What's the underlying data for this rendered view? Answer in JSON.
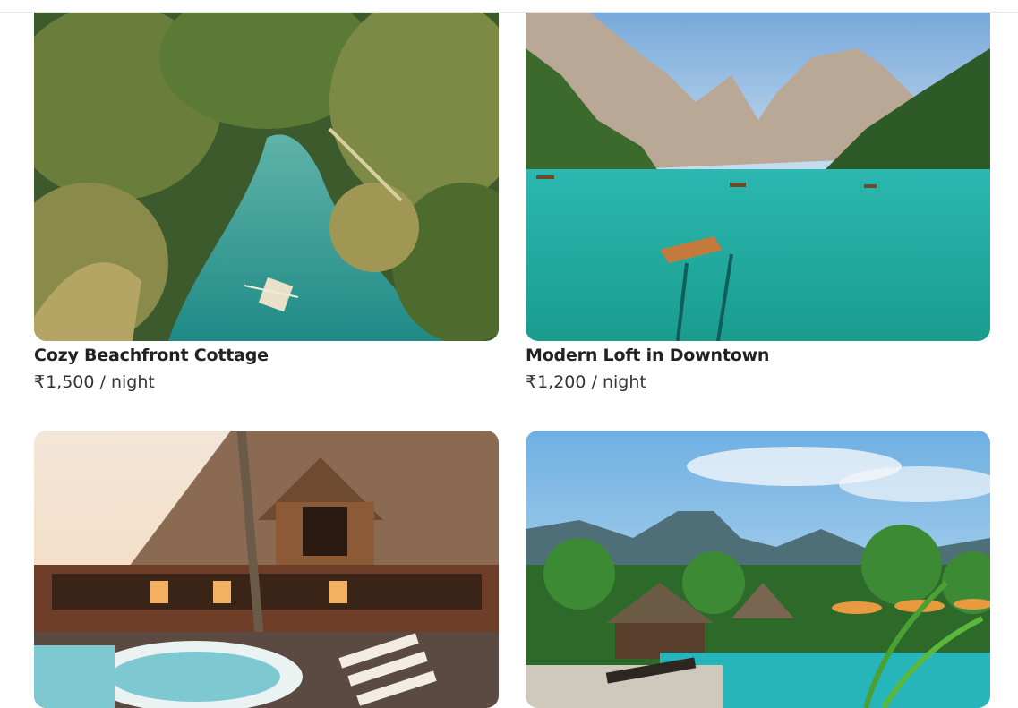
{
  "listings": [
    {
      "title": "Cozy Beachfront Cottage",
      "currency": "₹",
      "price": "1,500",
      "unit": "/ night"
    },
    {
      "title": "Modern Loft in Downtown",
      "currency": "₹",
      "price": "1,200",
      "unit": "/ night"
    },
    {
      "title": "",
      "currency": "",
      "price": "",
      "unit": ""
    },
    {
      "title": "",
      "currency": "",
      "price": "",
      "unit": ""
    }
  ]
}
